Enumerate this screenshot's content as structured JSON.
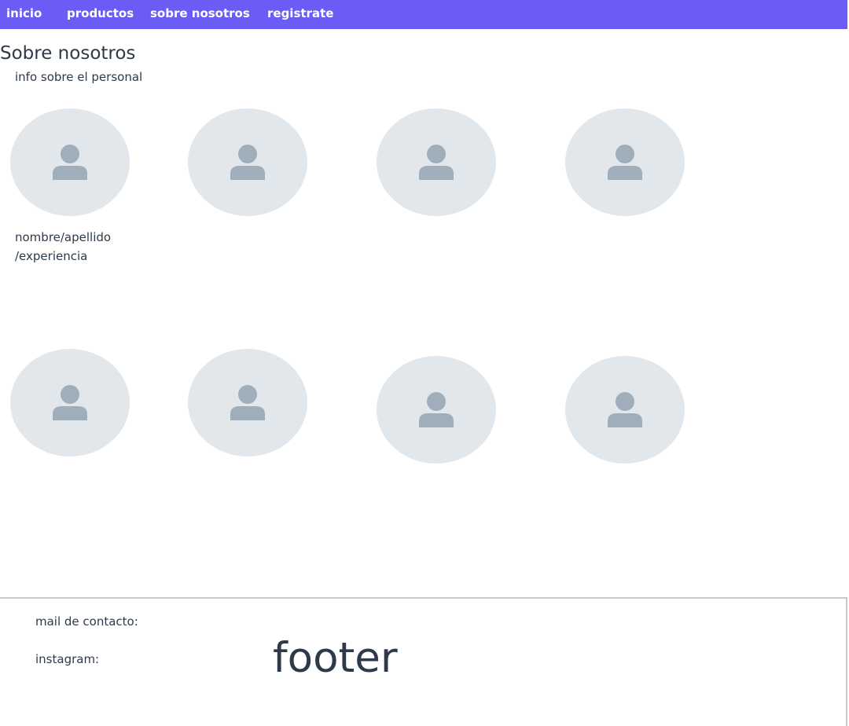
{
  "nav": {
    "items": [
      {
        "label": "inicio"
      },
      {
        "label": "productos"
      },
      {
        "label": "sobre nosotros"
      },
      {
        "label": "registrate"
      }
    ]
  },
  "main": {
    "title": "Sobre nosotros",
    "subtitle": "info sobre el personal",
    "member_caption": {
      "line1": "nombre/apellido",
      "line2": "/experiencia"
    },
    "avatars": [
      {
        "icon": "user-placeholder-icon"
      },
      {
        "icon": "user-placeholder-icon"
      },
      {
        "icon": "user-placeholder-icon"
      },
      {
        "icon": "user-placeholder-icon"
      },
      {
        "icon": "user-placeholder-icon"
      },
      {
        "icon": "user-placeholder-icon"
      },
      {
        "icon": "user-placeholder-icon"
      },
      {
        "icon": "user-placeholder-icon"
      }
    ]
  },
  "footer": {
    "mail_label": "mail de contacto:",
    "instagram_label": "instagram:",
    "big_text": "footer"
  },
  "colors": {
    "nav_bg": "#6b5cf6",
    "avatar_bg": "#e2e7ec",
    "avatar_icon": "#a0aebb",
    "text": "#2d3a4a",
    "footer_border": "#c2cbd4"
  }
}
